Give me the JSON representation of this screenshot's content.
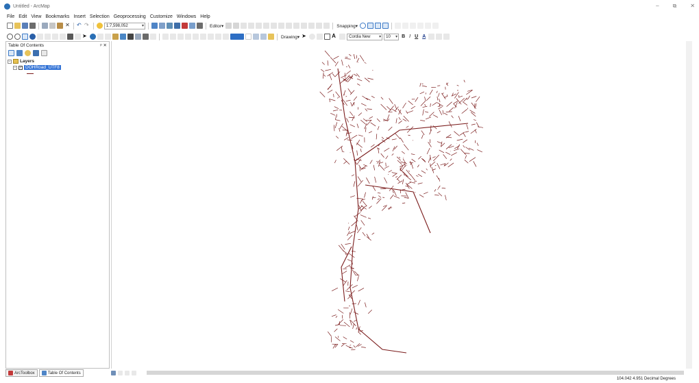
{
  "window": {
    "title": "Untitled - ArcMap",
    "minimize": "–",
    "restore": "⧉",
    "close": "✕"
  },
  "menu": [
    "File",
    "Edit",
    "View",
    "Bookmarks",
    "Insert",
    "Selection",
    "Geoprocessing",
    "Customize",
    "Windows",
    "Help"
  ],
  "toolbar": {
    "scale": "1:7,598,052",
    "editor_label": "Editor▾",
    "snapping_label": "Snapping▾",
    "drawing_label": "Drawing▾",
    "font_name": "Cordia New",
    "font_size": "10",
    "bold": "B",
    "italic": "I",
    "underline": "U",
    "font_color_label": "A"
  },
  "toc": {
    "title": "Table Of Contents",
    "pin": "ᵖ",
    "close": "✕",
    "root_label": "Layers",
    "layer_name": "DOHRoad_UTF8",
    "layer_checked": "✓",
    "expander_root": "−",
    "expander_layer": "−"
  },
  "map": {
    "line_color": "#7a1b1b"
  },
  "bottom_tabs": [
    "ArcToolbox",
    "Table Of Contents"
  ],
  "status": {
    "coordinates": "104.042  4.951 Decimal Degrees"
  }
}
